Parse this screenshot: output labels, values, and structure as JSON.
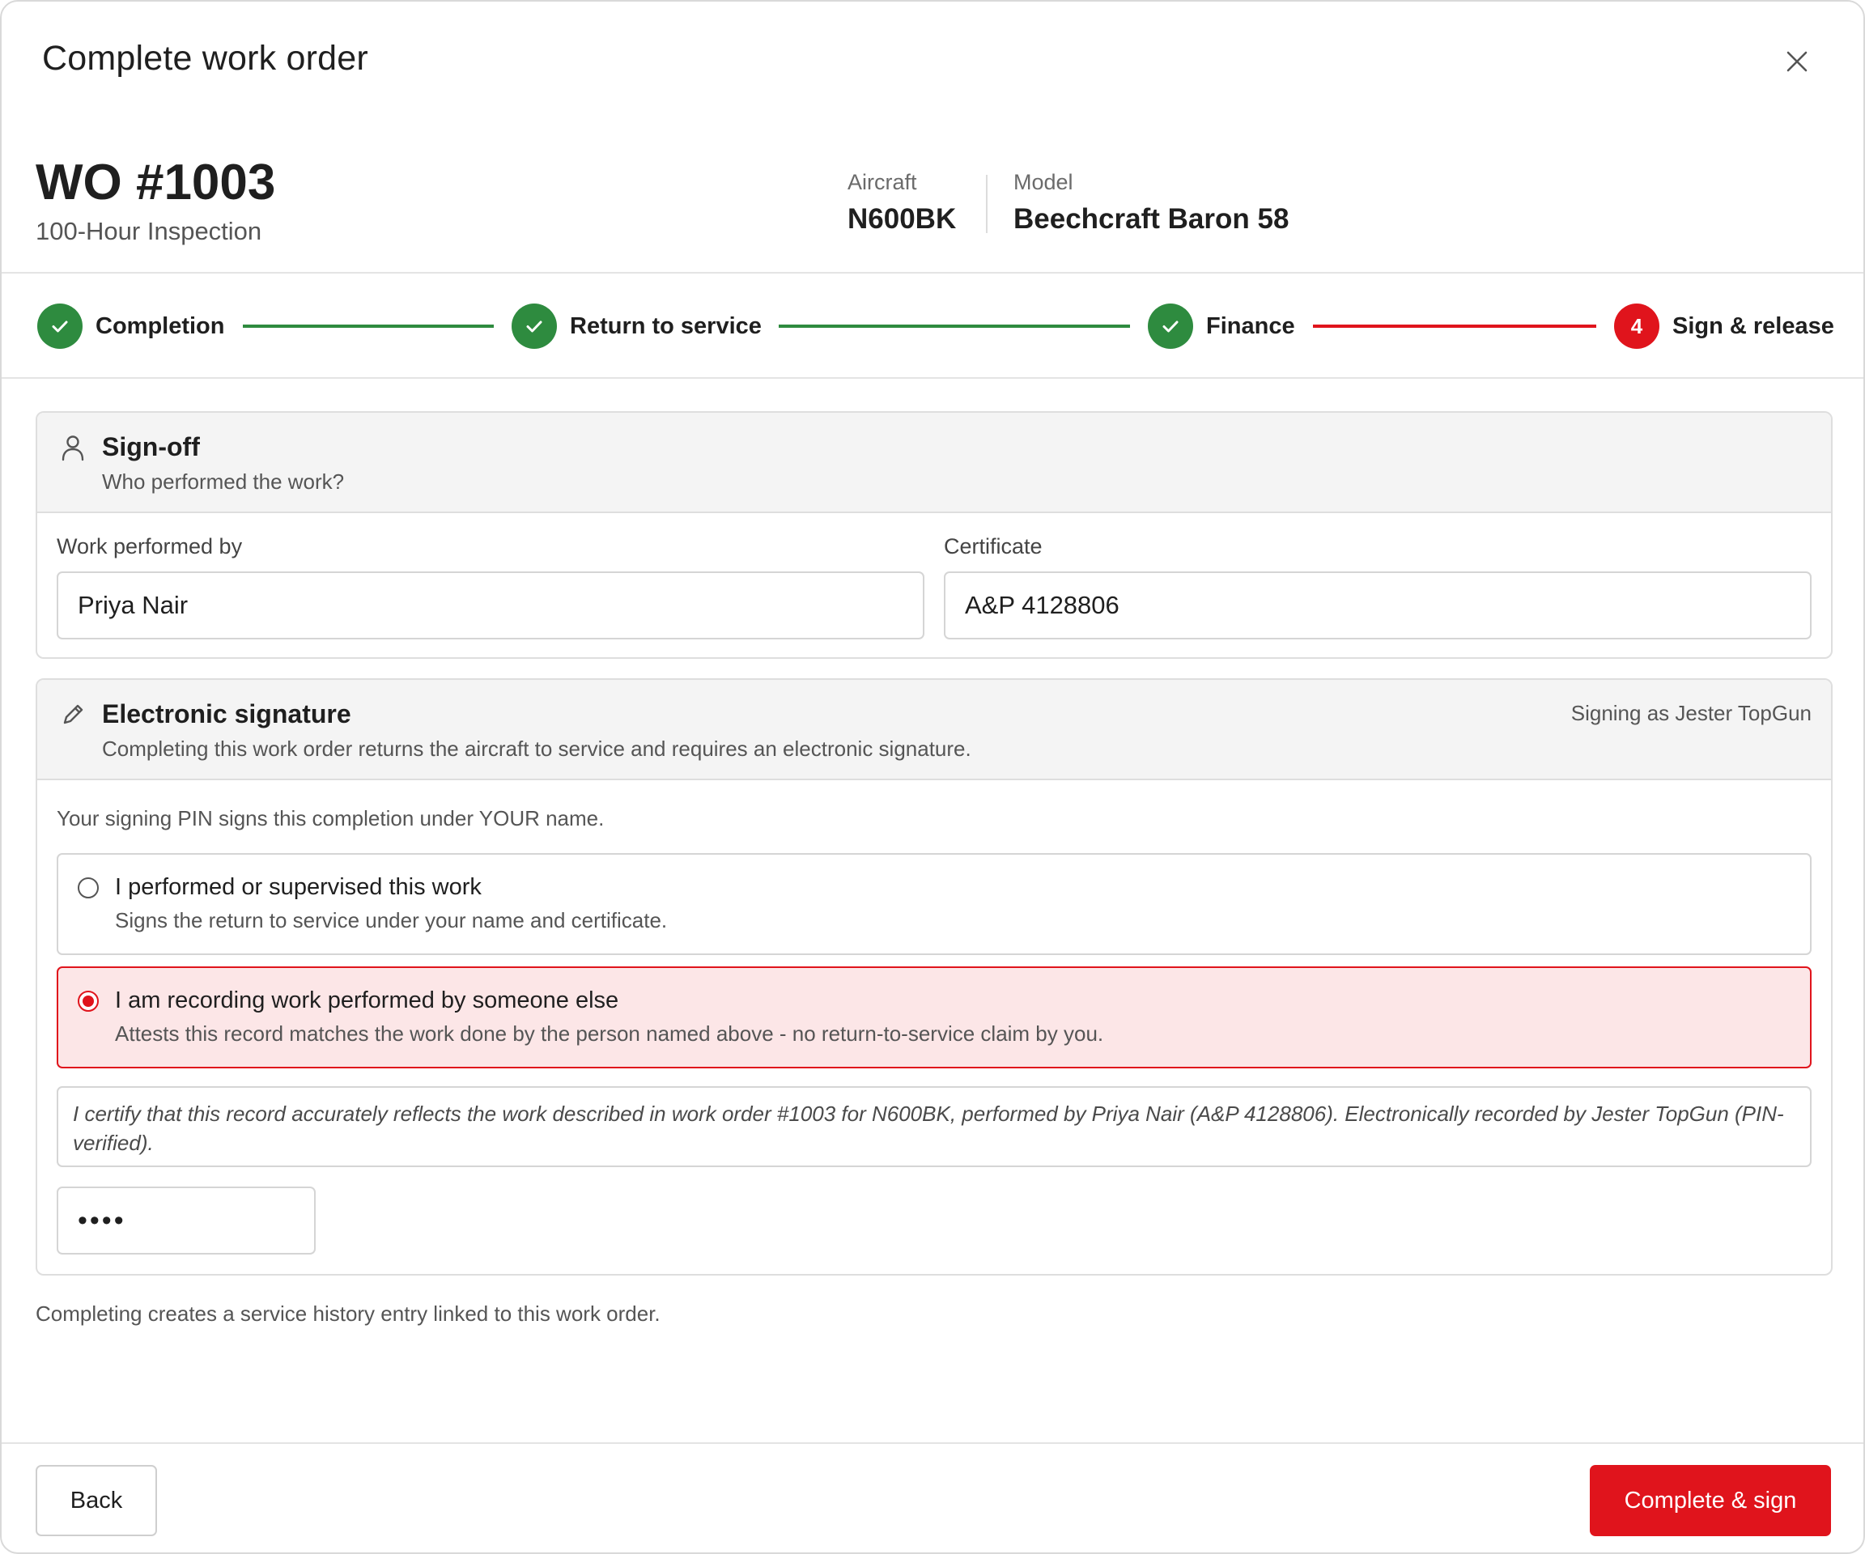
{
  "modal": {
    "title": "Complete work order"
  },
  "work_order": {
    "number": "WO #1003",
    "type": "100-Hour Inspection",
    "aircraft_label": "Aircraft",
    "aircraft_value": "N600BK",
    "model_label": "Model",
    "model_value": "Beechcraft Baron 58"
  },
  "stepper": {
    "steps": [
      {
        "label": "Completion",
        "status": "done"
      },
      {
        "label": "Return to service",
        "status": "done"
      },
      {
        "label": "Finance",
        "status": "done"
      },
      {
        "label": "Sign & release",
        "status": "active",
        "number": "4"
      }
    ]
  },
  "signoff": {
    "icon": "user-icon",
    "title": "Sign-off",
    "subtitle": "Who performed the work?",
    "performed_by_label": "Work performed by",
    "performed_by_value": "Priya Nair",
    "certificate_label": "Certificate",
    "certificate_value": "A&P 4128806"
  },
  "esign": {
    "icon": "pencil-icon",
    "title": "Electronic signature",
    "subtitle": "Completing this work order returns the aircraft to service and requires an electronic signature.",
    "signing_as": "Signing as Jester TopGun",
    "pin_note": "Your signing PIN signs this completion under YOUR name.",
    "options": [
      {
        "title": "I performed or supervised this work",
        "description": "Signs the return to service under your name and certificate.",
        "selected": false
      },
      {
        "title": "I am recording work performed by someone else",
        "description": "Attests this record matches the work done by the person named above - no return-to-service claim by you.",
        "selected": true
      }
    ],
    "certification": "I certify that this record accurately reflects the work described in work order #1003 for N600BK, performed by Priya Nair (A&P 4128806). Electronically recorded by Jester TopGun (PIN-verified).",
    "pin_value": "••••"
  },
  "footer": {
    "note": "Completing creates a service history entry linked to this work order.",
    "back_label": "Back",
    "submit_label": "Complete & sign"
  },
  "colors": {
    "accent": "#e0141c",
    "success": "#2e8b3f",
    "selected_bg": "#fce6e7"
  }
}
